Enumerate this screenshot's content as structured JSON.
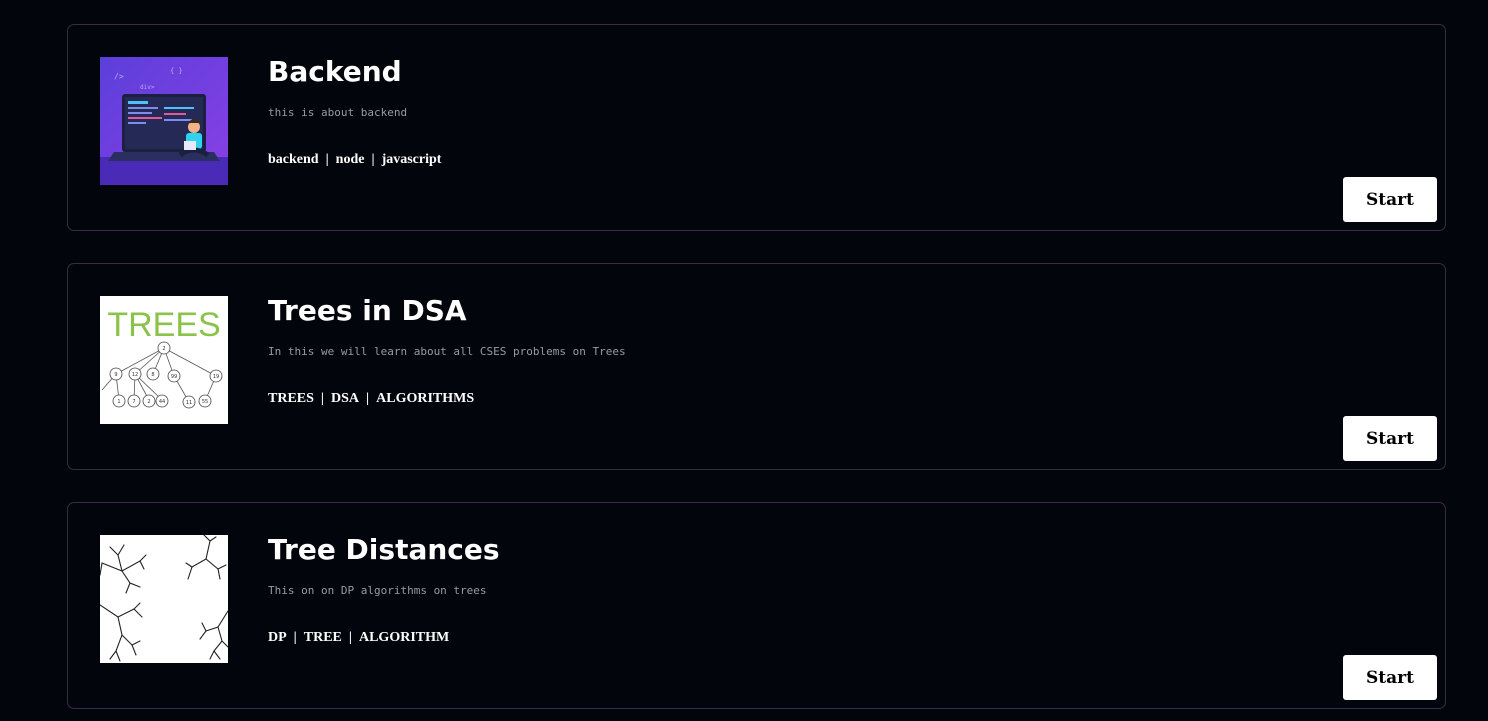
{
  "courses": [
    {
      "title": "Backend",
      "description": "this is about backend",
      "tags": [
        "backend",
        "node",
        "javascript"
      ],
      "tag_separator": "|",
      "button_label": "Start",
      "thumbnail_icon": "laptop-coder-illustration-icon"
    },
    {
      "title": "Trees in DSA",
      "description": "In this we will learn about all CSES problems on Trees",
      "tags": [
        "TREES",
        "DSA",
        "ALGORITHMS"
      ],
      "tag_separator": "|",
      "button_label": "Start",
      "thumbnail_icon": "tree-diagram-icon",
      "thumbnail_text": "TREES",
      "thumbnail_nodes": [
        "2",
        "9",
        "12",
        "8",
        "99",
        "19",
        "1",
        "7",
        "2",
        "44",
        "11",
        "55"
      ]
    },
    {
      "title": "Tree Distances",
      "description": "This on on DP algorithms on trees",
      "tags": [
        "DP",
        "TREE",
        "ALGORITHM"
      ],
      "tag_separator": "|",
      "button_label": "Start",
      "thumbnail_icon": "branching-trees-icon"
    }
  ],
  "colors": {
    "background": "#03050c",
    "card_border": "#3a2a48",
    "title": "#ffffff",
    "description": "#9a9aa6",
    "button_bg": "#ffffff",
    "button_text": "#000000",
    "trees_green": "#8bc34a",
    "illustration_purple": "#6a3fe0"
  }
}
